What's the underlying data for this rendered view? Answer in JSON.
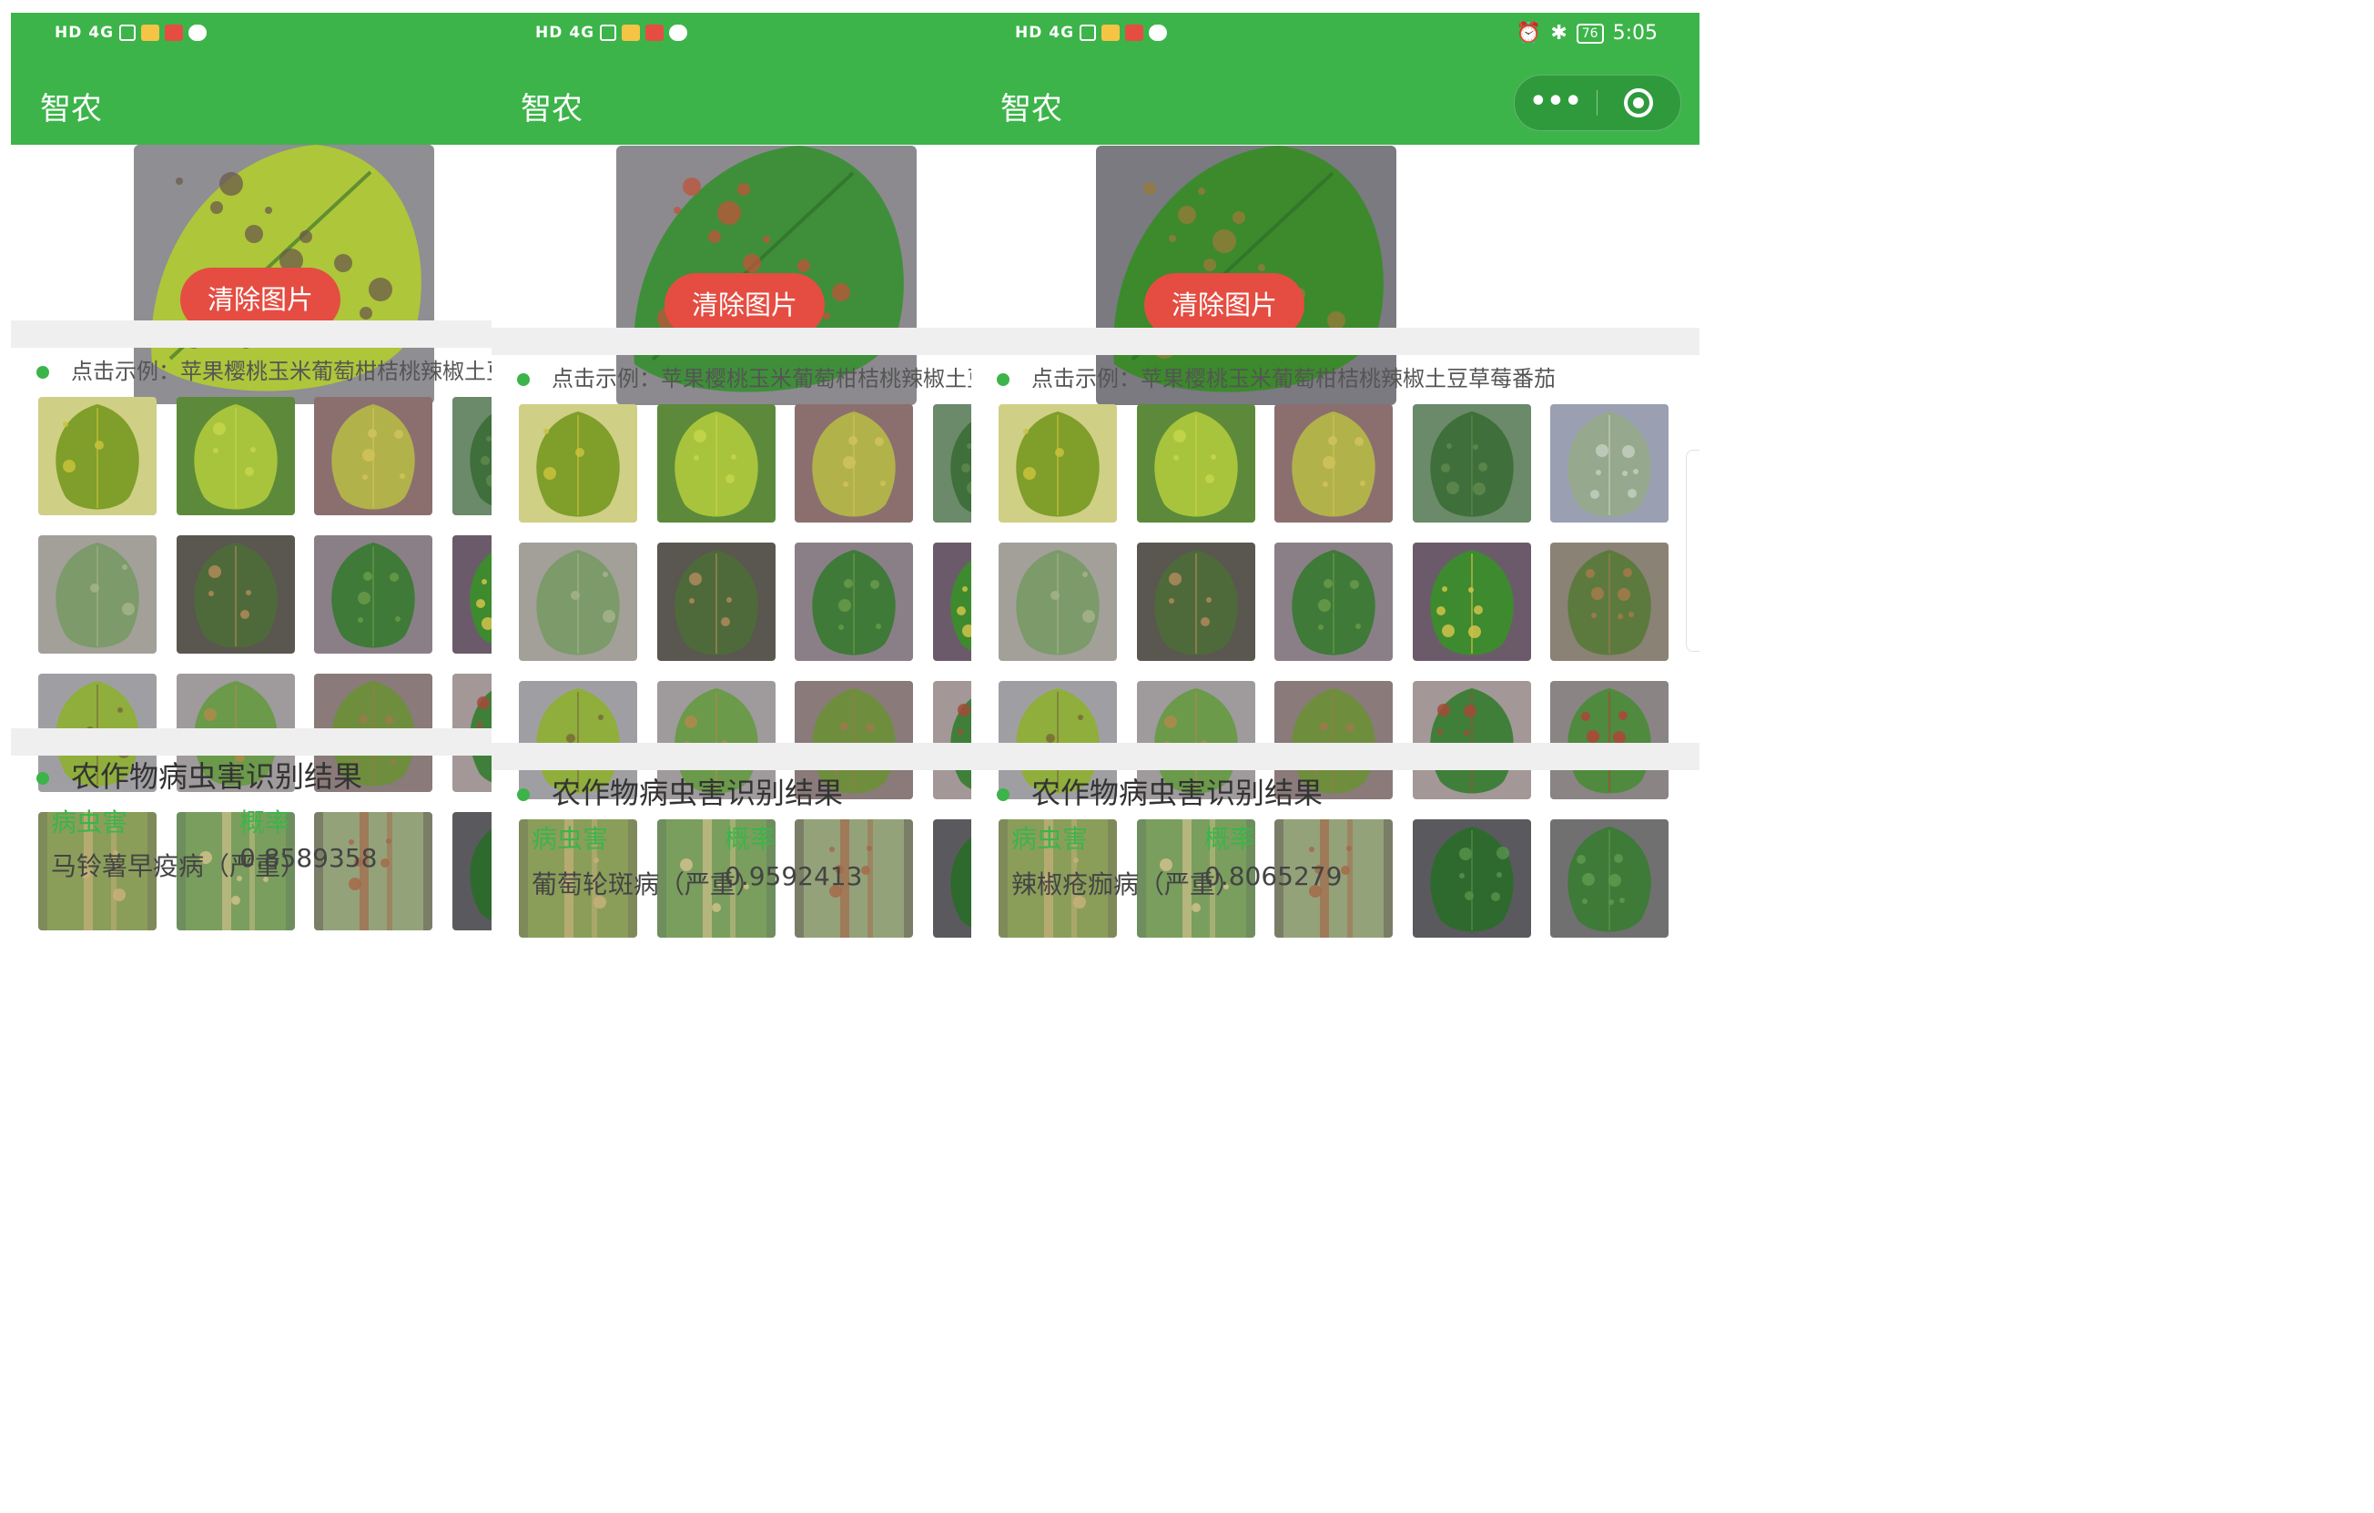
{
  "status_bar": {
    "network": "HD 4G",
    "time": "5:05",
    "battery": "76"
  },
  "app": {
    "title": "智农",
    "more_icon": "more-dots-icon",
    "close_icon": "target-close-icon"
  },
  "clear_button": "清除图片",
  "examples_hint": "点击示例：苹果樱桃玉米葡萄柑桔桃辣椒土豆草莓番茄",
  "result": {
    "title": "农作物病虫害识别结果",
    "col_disease": "病虫害",
    "col_prob": "概率"
  },
  "screens": [
    {
      "disease": "马铃薯早疫病（严重）",
      "probability": "0.8589358"
    },
    {
      "disease": "葡萄轮斑病（严重）",
      "probability": "0.9592413"
    },
    {
      "disease": "辣椒疮痂病（严重）",
      "probability": "0.8065279"
    }
  ],
  "colors": {
    "brand_green": "#3cb44a",
    "clear_red": "#e54d42",
    "band_gray": "#efefef"
  },
  "sample_leaves": [
    "yellow-curled-leaf",
    "lime-green-leaf",
    "yellow-round-leaf",
    "dark-wrinkled-leaf",
    "grey-green-leaf",
    "grape-lobed-leaf",
    "brown-spotted-leaf",
    "serrated-leaf",
    "shiny-green-leaf",
    "curled-brown-leaf",
    "spotted-potato-leaf",
    "spotted-oval-leaf",
    "spotted-round-leaf",
    "grape-spotted-leaf",
    "grape-rust-leaf",
    "corn-streak-leaf",
    "corn-stripe-leaf",
    "corn-rust-leaf",
    "veined-dark-leaf",
    "heart-green-leaf"
  ]
}
